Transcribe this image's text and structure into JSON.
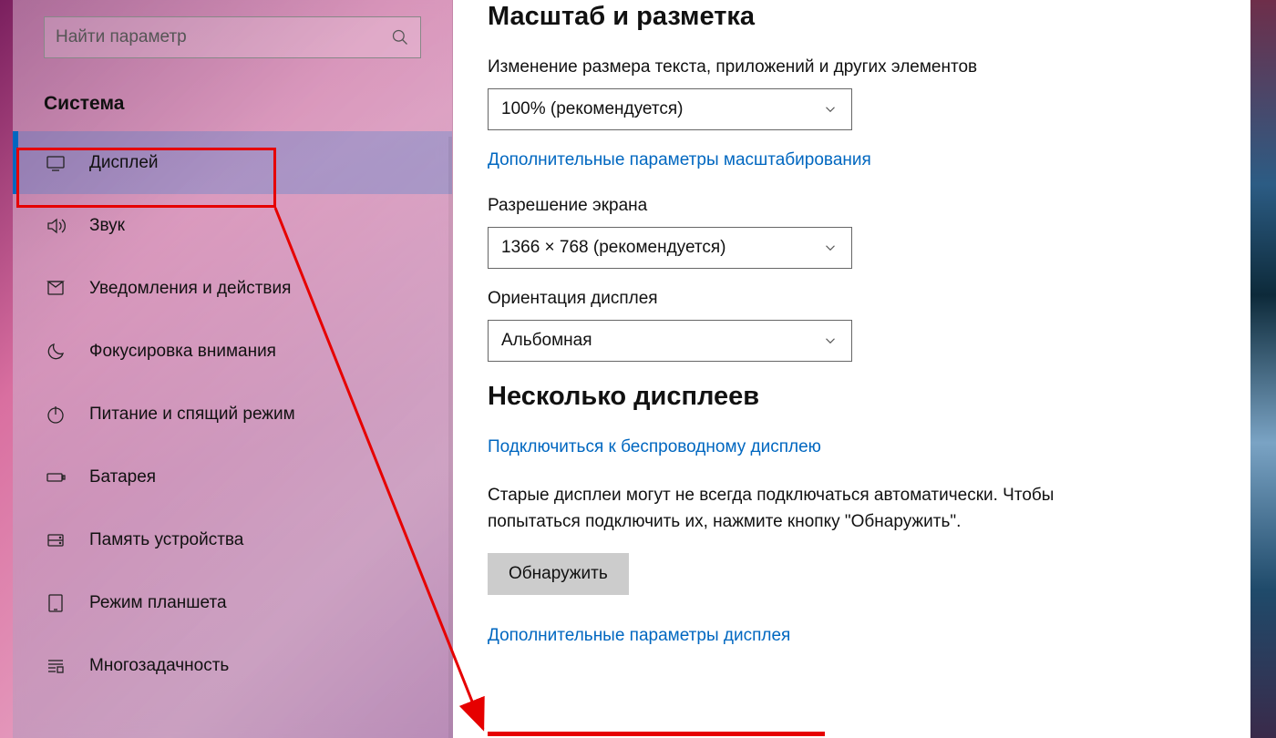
{
  "search": {
    "placeholder": "Найти параметр"
  },
  "sidebar": {
    "category": "Система",
    "items": [
      {
        "label": "Дисплей"
      },
      {
        "label": "Звук"
      },
      {
        "label": "Уведомления и действия"
      },
      {
        "label": "Фокусировка внимания"
      },
      {
        "label": "Питание и спящий режим"
      },
      {
        "label": "Батарея"
      },
      {
        "label": "Память устройства"
      },
      {
        "label": "Режим планшета"
      },
      {
        "label": "Многозадачность"
      }
    ]
  },
  "main": {
    "scale": {
      "heading": "Масштаб и разметка",
      "sizeLabel": "Изменение размера текста, приложений и других элементов",
      "sizeValue": "100% (рекомендуется)",
      "advancedLink": "Дополнительные параметры масштабирования",
      "resolutionLabel": "Разрешение экрана",
      "resolutionValue": "1366 × 768 (рекомендуется)",
      "orientationLabel": "Ориентация дисплея",
      "orientationValue": "Альбомная"
    },
    "multi": {
      "heading": "Несколько дисплеев",
      "wirelessLink": "Подключиться к беспроводному дисплею",
      "oldDisplaysText": "Старые дисплеи могут не всегда подключаться автоматически. Чтобы попытаться подключить их, нажмите кнопку \"Обнаружить\".",
      "detectButton": "Обнаружить",
      "advancedDisplayLink": "Дополнительные параметры дисплея"
    }
  },
  "colors": {
    "accent": "#0067c0",
    "annotation": "#e60000"
  }
}
